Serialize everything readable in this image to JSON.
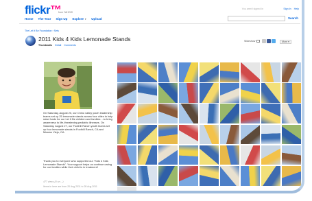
{
  "header": {
    "logo_main": "flickr",
    "logo_tm": "™",
    "logo_sub": "from YAHOO!",
    "signed_in": "You aren't signed in",
    "util_links": [
      "Sign In",
      "Help"
    ],
    "nav": [
      "Home",
      "The Tour",
      "Sign Up",
      "Explore",
      "Upload"
    ],
    "search_placeholder": "",
    "search_button": "Search"
  },
  "breadcrumb": "The Let It Be Foundation › Sets",
  "set": {
    "title": "2011 Kids 4 Kids Lemonade Stands",
    "tabs": [
      "Thumbnails",
      "Detail",
      "Comments"
    ],
    "slideshow_label": "Slideshow",
    "more_label": "More ▾"
  },
  "description": "On Saturday, August 20, our Chino valley youth leadership teams set up 25 lemonade stands across four cities to help raise funds for our Let It Be children and families ...to bring awareness to life-threatening pediatric illnesses. On Saturday, August 27, our Foothill Ranch youth teams set up four lemonade stands in Foothill Ranch, CA and Mission Viejo, CA.",
  "thanks": "Thank you to everyone who supported our \"Kids 4 Kids Lemonade Stands\". Your support helps us continue caring for our families while their child is in treatment!",
  "meta_views": "477 views (0 on ...)",
  "meta_dates": "Items in here are from 20 Aug 2011 to 28 Aug 2011",
  "colors": {
    "flickr_blue": "#0063dc",
    "flickr_pink": "#ff0084",
    "frame_border": "#9fbcdc"
  },
  "icons": [
    "planet-set-icon",
    "play-icon",
    "email-share-icon",
    "facebook-share-icon",
    "twitter-share-icon"
  ],
  "photos_count_visible": 55
}
